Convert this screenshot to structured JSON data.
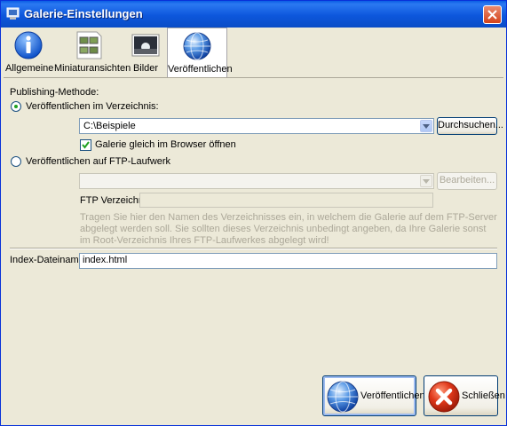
{
  "window": {
    "title": "Galerie-Einstellungen"
  },
  "toolbar": {
    "tabs": [
      {
        "label": "Allgemeine"
      },
      {
        "label": "Miniaturansichten"
      },
      {
        "label": "Bilder"
      },
      {
        "label": "Veröffentlichen"
      }
    ]
  },
  "publishing": {
    "method_label": "Publishing-Methode:",
    "local": {
      "radio_label": "Veröffentlichen im Verzeichnis:",
      "path_value": "C:\\Beispiele",
      "browse_label": "Durchsuchen...",
      "open_in_browser_label": "Galerie gleich im Browser öffnen"
    },
    "ftp": {
      "radio_label": "Veröffentlichen auf FTP-Laufwerk",
      "drive_value": "",
      "edit_label": "Bearbeiten...",
      "dir_label": "FTP Verzeichnis",
      "dir_value": "",
      "hint": "Tragen Sie hier den Namen des Verzeichnisses ein, in welchem die Galerie auf dem FTP-Server abgelegt werden soll. Sie sollten dieses Verzeichnis unbedingt angeben, da Ihre Galerie sonst im Root-Verzeichnis Ihres FTP-Laufwerkes abgelegt wird!"
    }
  },
  "index": {
    "label": "Index-Dateinamen",
    "value": "index.html"
  },
  "footer": {
    "publish_label": "Veröffentlichen",
    "close_label": "Schließen"
  },
  "colors": {
    "titlebar": "#0a5ee4",
    "dialog_bg": "#ece9d8",
    "radio_dot": "#21a121",
    "check": "#21a121",
    "disabled_text": "#aca899"
  }
}
